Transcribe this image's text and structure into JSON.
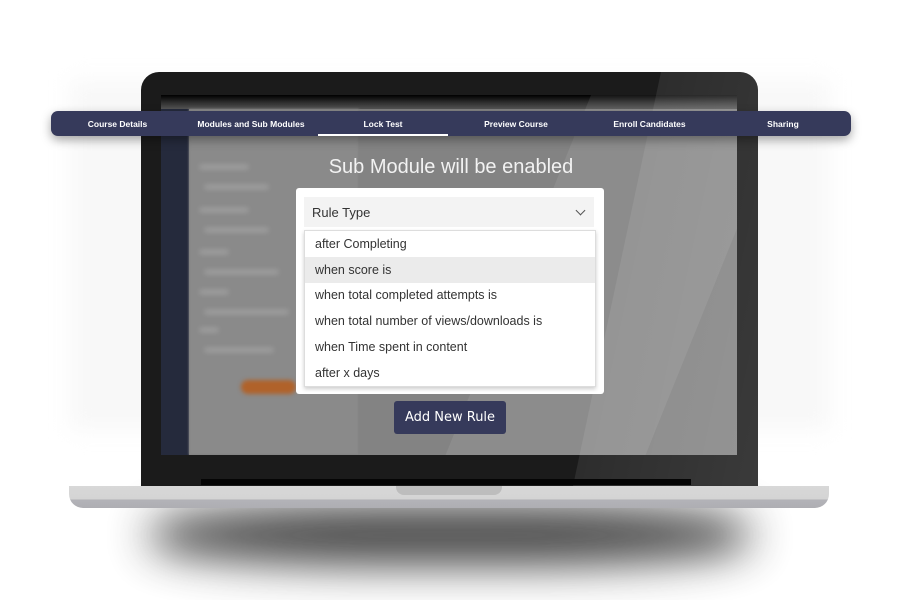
{
  "nav": {
    "tabs": [
      {
        "label": "Course Details",
        "active": false
      },
      {
        "label": "Modules and Sub Modules",
        "active": false
      },
      {
        "label": "Lock Test",
        "active": true
      },
      {
        "label": "Preview Course",
        "active": false
      },
      {
        "label": "Enroll Candidates",
        "active": false
      },
      {
        "label": "Sharing",
        "active": false
      }
    ]
  },
  "modal": {
    "title": "Sub Module will be enabled",
    "rule_select": {
      "placeholder": "Rule Type",
      "options": [
        "after Completing",
        "when score is",
        "when total completed attempts is",
        "when total number of views/downloads is",
        "when Time spent in content",
        "after x days"
      ],
      "highlighted_index": 1
    },
    "add_button_label": "Add New Rule"
  },
  "colors": {
    "brand": "#363a5b",
    "highlight": "#ebebeb"
  }
}
